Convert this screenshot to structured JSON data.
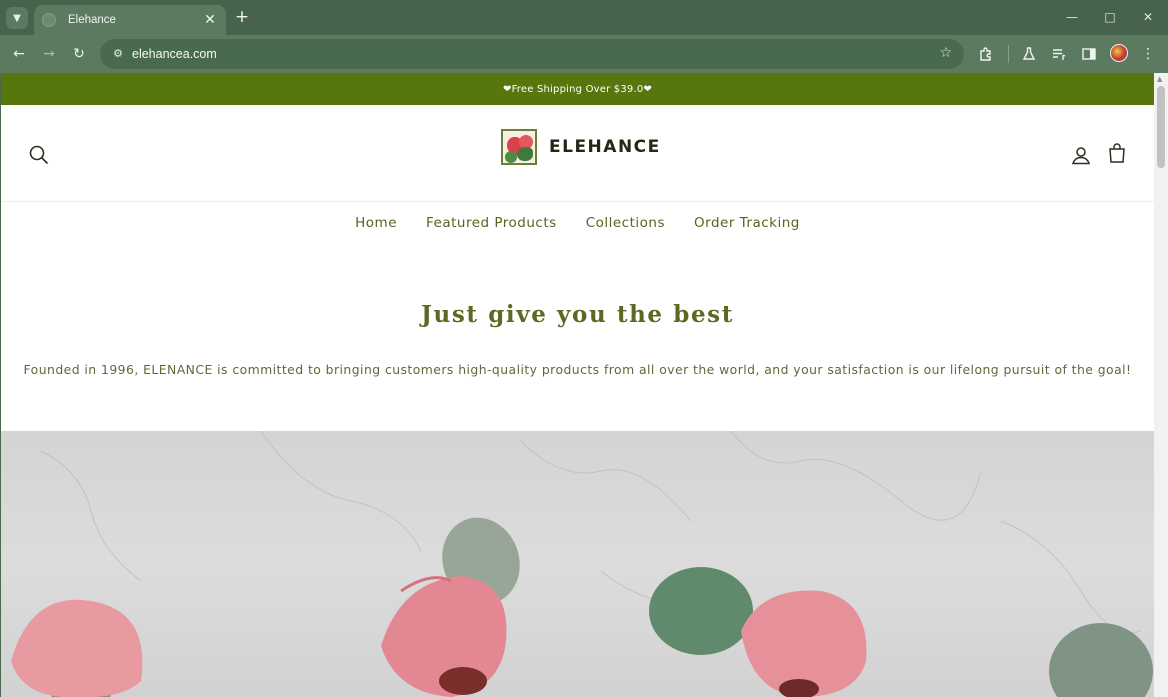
{
  "browser": {
    "tab": {
      "title": "Elehance"
    },
    "url": "elehancea.com"
  },
  "page": {
    "announcement": "❤Free Shipping Over $39.0❤",
    "logo_text": "ELEHANCE",
    "nav": [
      {
        "label": "Home"
      },
      {
        "label": "Featured Products"
      },
      {
        "label": "Collections"
      },
      {
        "label": "Order Tracking"
      }
    ],
    "hero": {
      "title": "Just give you the best",
      "description": "Founded in 1996, ELENANCE is committed to bringing customers high-quality products from all over the world, and your satisfaction is our lifelong pursuit of the goal!"
    }
  },
  "colors": {
    "brand_green": "#56770d",
    "text_green": "#5a6a22",
    "chrome": "#5b7a5f"
  },
  "icons": [
    "search-icon",
    "account-icon",
    "cart-icon",
    "flask-icon",
    "reading-list-icon",
    "side-panel-icon",
    "extensions-icon",
    "star-icon"
  ]
}
